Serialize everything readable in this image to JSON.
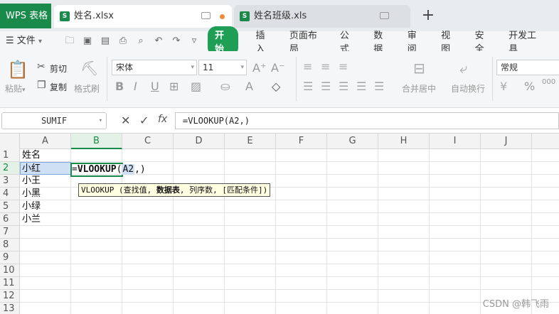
{
  "tabs": {
    "app": "WPS 表格",
    "active": "姓名.xlsx",
    "inactive": "姓名班级.xls",
    "new_tab": "+"
  },
  "menu": {
    "file": "文件",
    "items": [
      "开始",
      "插入",
      "页面布局",
      "公式",
      "数据",
      "审阅",
      "视图",
      "安全",
      "开发工具"
    ]
  },
  "ribbon": {
    "paste": "粘贴",
    "cut": "剪切",
    "copy": "复制",
    "format_painter": "格式刷",
    "font_name": "宋体",
    "font_size": "11",
    "merge_center": "合并居中",
    "wrap_text": "自动换行",
    "number_format": "常规"
  },
  "formula_bar": {
    "name_box": "SUMIF",
    "formula": "=VLOOKUP(A2,)"
  },
  "grid": {
    "columns": [
      "A",
      "B",
      "C",
      "D",
      "E",
      "F",
      "G",
      "H",
      "I",
      "J"
    ],
    "rows": [
      "1",
      "2",
      "3",
      "4",
      "5",
      "6",
      "7",
      "8",
      "9",
      "10",
      "11",
      "12",
      "13"
    ],
    "column_a": [
      "姓名",
      "小红",
      "小王",
      "小黑",
      "小绿",
      "小兰"
    ],
    "edit_prefix": "=",
    "edit_fn": "VLOOKUP",
    "edit_open": "(",
    "edit_ref": "A2",
    "edit_close": ",)",
    "tooltip_pre": "VLOOKUP (查找值, ",
    "tooltip_bold": "数据表",
    "tooltip_post": ", 列序数, [匹配条件])"
  },
  "watermark": "CSDN @韩飞雨"
}
